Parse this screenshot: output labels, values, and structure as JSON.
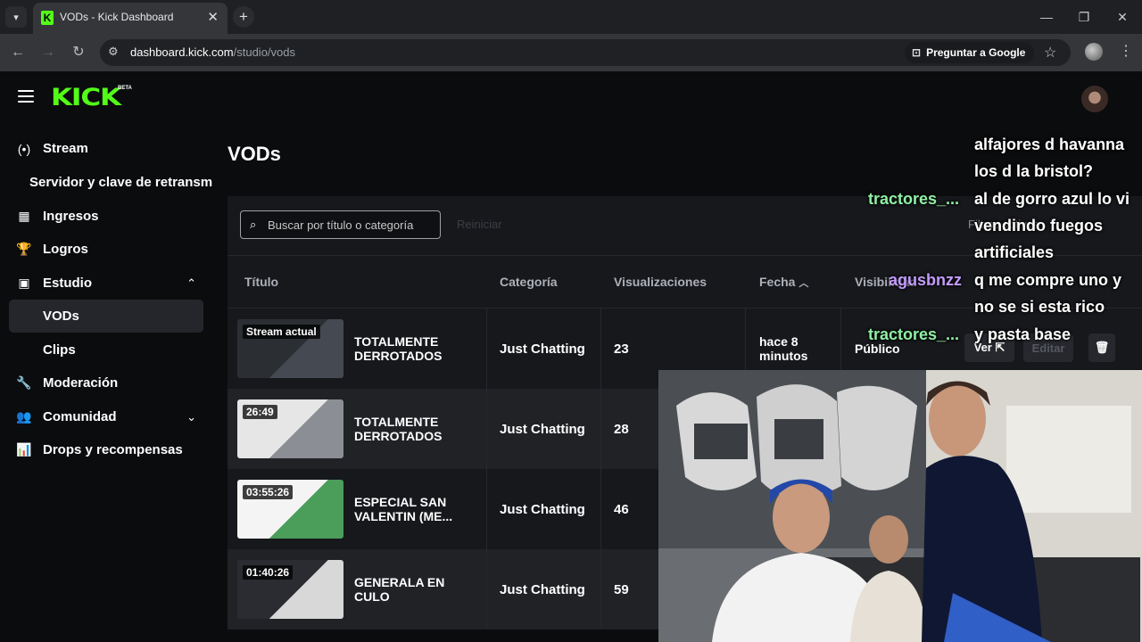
{
  "browser": {
    "tab_title": "VODs - Kick Dashboard",
    "tab_favicon": "K",
    "url_host": "dashboard.kick.com",
    "url_path": "/studio/vods",
    "ask_google": "Preguntar a Google",
    "icons": [
      "tab-search-icon",
      "close-icon",
      "plus-icon",
      "minimize-icon",
      "restore-icon",
      "back-icon",
      "forward-icon",
      "reload-icon",
      "site-info-icon",
      "google-lens-icon",
      "star-icon",
      "profile-icon",
      "more-icon"
    ]
  },
  "header": {
    "logo": "KICK",
    "beta": "BETA"
  },
  "sidebar": {
    "items": [
      {
        "label": "Stream",
        "icon": "(•)"
      },
      {
        "label": "Servidor y clave de retransm"
      },
      {
        "label": "Ingresos",
        "icon": "▦"
      },
      {
        "label": "Logros",
        "icon": "🏆"
      },
      {
        "label": "Estudio",
        "icon": "▣",
        "chevron": "⌃"
      },
      {
        "label": "VODs"
      },
      {
        "label": "Clips"
      },
      {
        "label": "Moderación",
        "icon": "🔧"
      },
      {
        "label": "Comunidad",
        "icon": "👥",
        "chevron": "⌄"
      },
      {
        "label": "Drops y recompensas",
        "icon": "📊"
      }
    ]
  },
  "main": {
    "title": "VODs",
    "search_placeholder": "Buscar por título o categoría",
    "reset_label": "Reiniciar",
    "filter_label": "Filtros activos",
    "columns": {
      "title": "Título",
      "category": "Categoría",
      "views": "Visualizaciones",
      "date": "Fecha",
      "visibility": "Visibilidad"
    },
    "rows": [
      {
        "badge": "Stream actual",
        "title": "TOTALMENTE DERROTADOS",
        "category": "Just Chatting",
        "views": "23",
        "date": "hace 8 minutos",
        "visibility": "Público",
        "view_btn": "Ver ⇱",
        "edit_btn": "Editar"
      },
      {
        "badge": "26:49",
        "title": "TOTALMENTE DERROTADOS",
        "category": "Just Chatting",
        "views": "28"
      },
      {
        "badge": "03:55:26",
        "title": "ESPECIAL SAN VALENTIN (ME...",
        "category": "Just Chatting",
        "views": "46"
      },
      {
        "badge": "01:40:26",
        "title": "GENERALA EN CULO",
        "category": "Just Chatting",
        "views": "59"
      }
    ]
  },
  "chat": {
    "lines": [
      {
        "text": "alfajores d havanna"
      },
      {
        "text": "los d la bristol?"
      },
      {
        "user": "tractores_...",
        "text": "al de gorro azul lo vi"
      },
      {
        "text": "vendindo fuegos"
      },
      {
        "text": "artificiales"
      },
      {
        "user": "agusbnzz",
        "text": "q me compre uno y"
      },
      {
        "text": "no se si esta rico"
      },
      {
        "user": "tractores_...",
        "text": "y pasta base"
      }
    ]
  },
  "colors": {
    "kick_green": "#53fc18",
    "bg": "#0b0c0e",
    "panel": "#17181c"
  }
}
